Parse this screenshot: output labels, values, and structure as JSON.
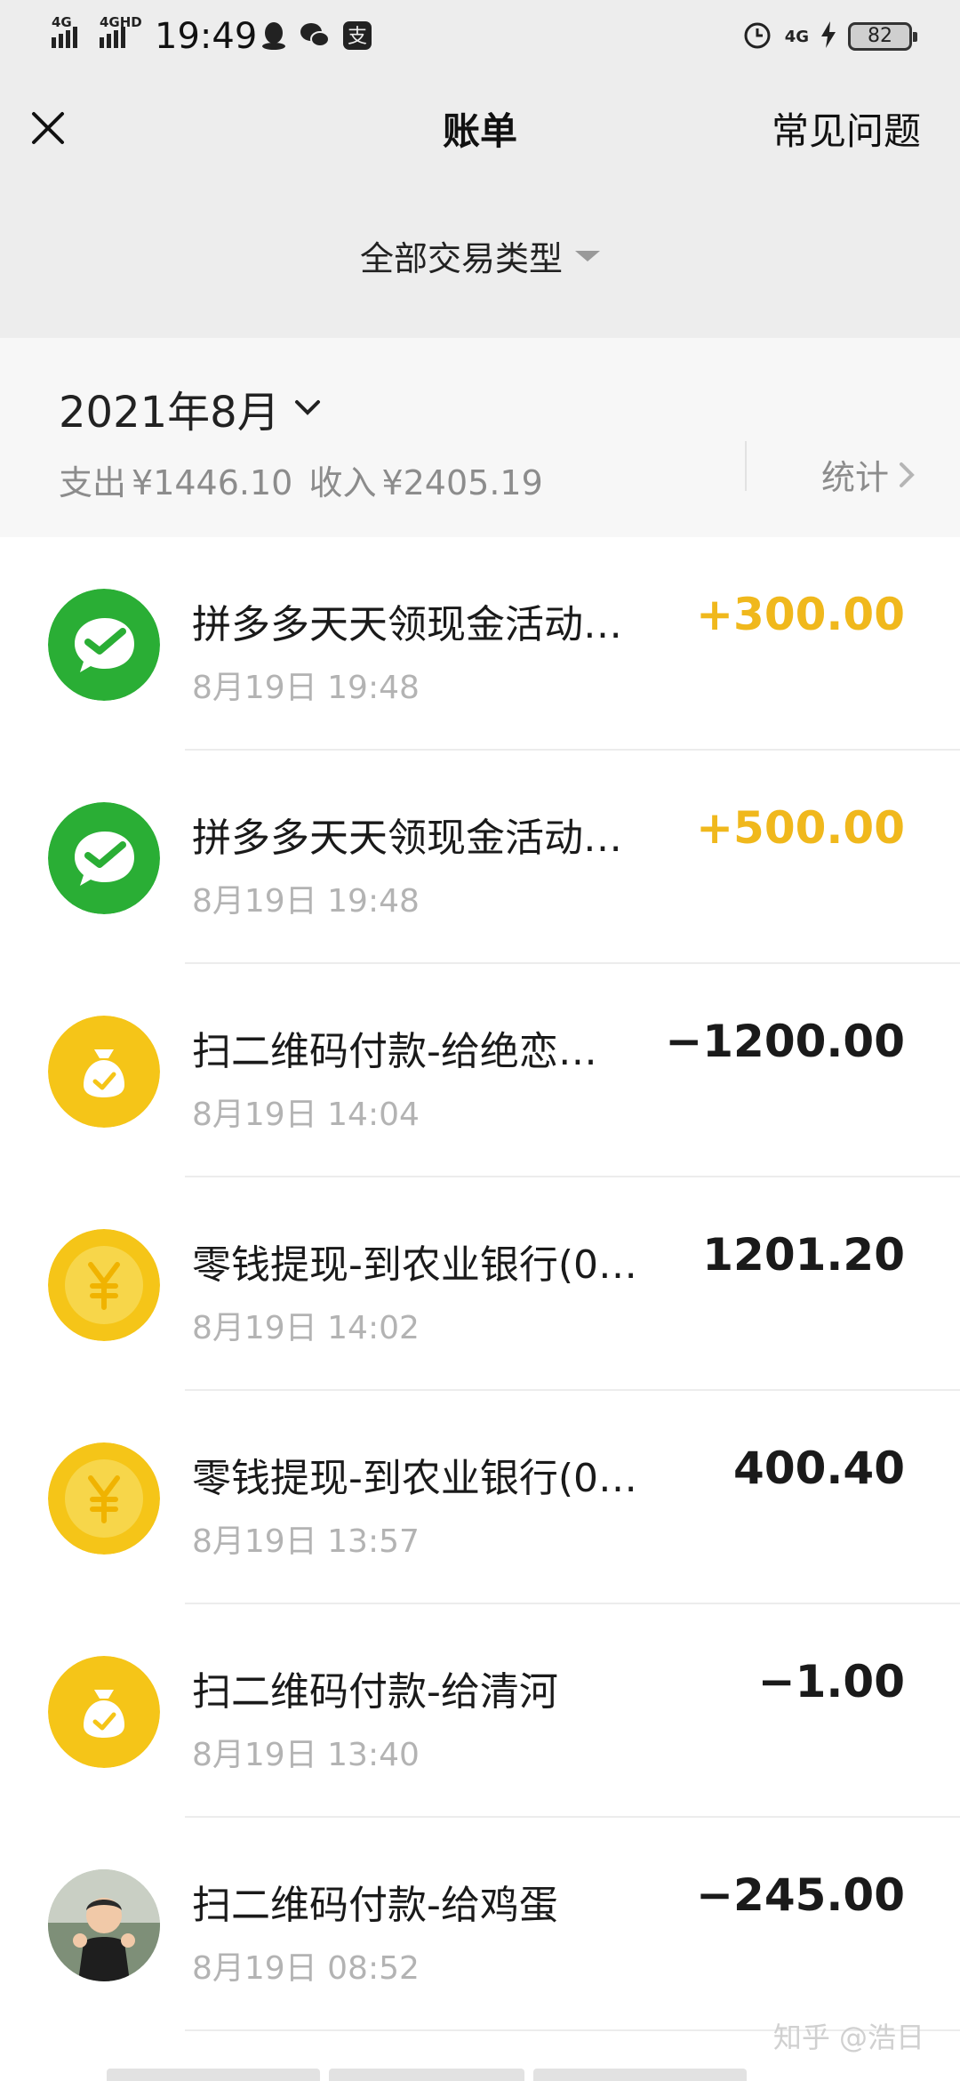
{
  "status_bar": {
    "network_1": "4G",
    "network_2": "4GHD",
    "time": "19:49",
    "battery": "82",
    "network_right": "4G"
  },
  "header": {
    "title": "账单",
    "faq": "常见问题"
  },
  "filter": {
    "label": "全部交易类型"
  },
  "month_summary": {
    "month": "2021年8月",
    "expense_label": "支出",
    "expense": "¥1446.10",
    "income_label": "收入",
    "income": "¥2405.19",
    "stats": "统计"
  },
  "transactions": [
    {
      "icon": "wechat-icon",
      "title": "拼多多天天领现金活动…",
      "time": "8月19日 19:48",
      "amount": "+300.00",
      "kind": "income"
    },
    {
      "icon": "wechat-icon",
      "title": "拼多多天天领现金活动…",
      "time": "8月19日 19:48",
      "amount": "+500.00",
      "kind": "income"
    },
    {
      "icon": "money-bag-icon",
      "title": "扫二维码付款-给绝恋…",
      "time": "8月19日 14:04",
      "amount": "−1200.00",
      "kind": "expense"
    },
    {
      "icon": "yuan-coin-icon",
      "title": "零钱提现-到农业银行(0…",
      "time": "8月19日 14:02",
      "amount": "1201.20",
      "kind": "neutral"
    },
    {
      "icon": "yuan-coin-icon",
      "title": "零钱提现-到农业银行(0…",
      "time": "8月19日 13:57",
      "amount": "400.40",
      "kind": "neutral"
    },
    {
      "icon": "money-bag-icon",
      "title": "扫二维码付款-给清河",
      "time": "8月19日 13:40",
      "amount": "−1.00",
      "kind": "expense"
    },
    {
      "icon": "avatar-photo",
      "title": "扫二维码付款-给鸡蛋",
      "time": "8月19日 08:52",
      "amount": "−245.00",
      "kind": "expense"
    }
  ],
  "watermark": "知乎 @浩日",
  "colors": {
    "wechat_green": "#2aae35",
    "gold": "#f5c518",
    "income_amount": "#f0b81c"
  }
}
